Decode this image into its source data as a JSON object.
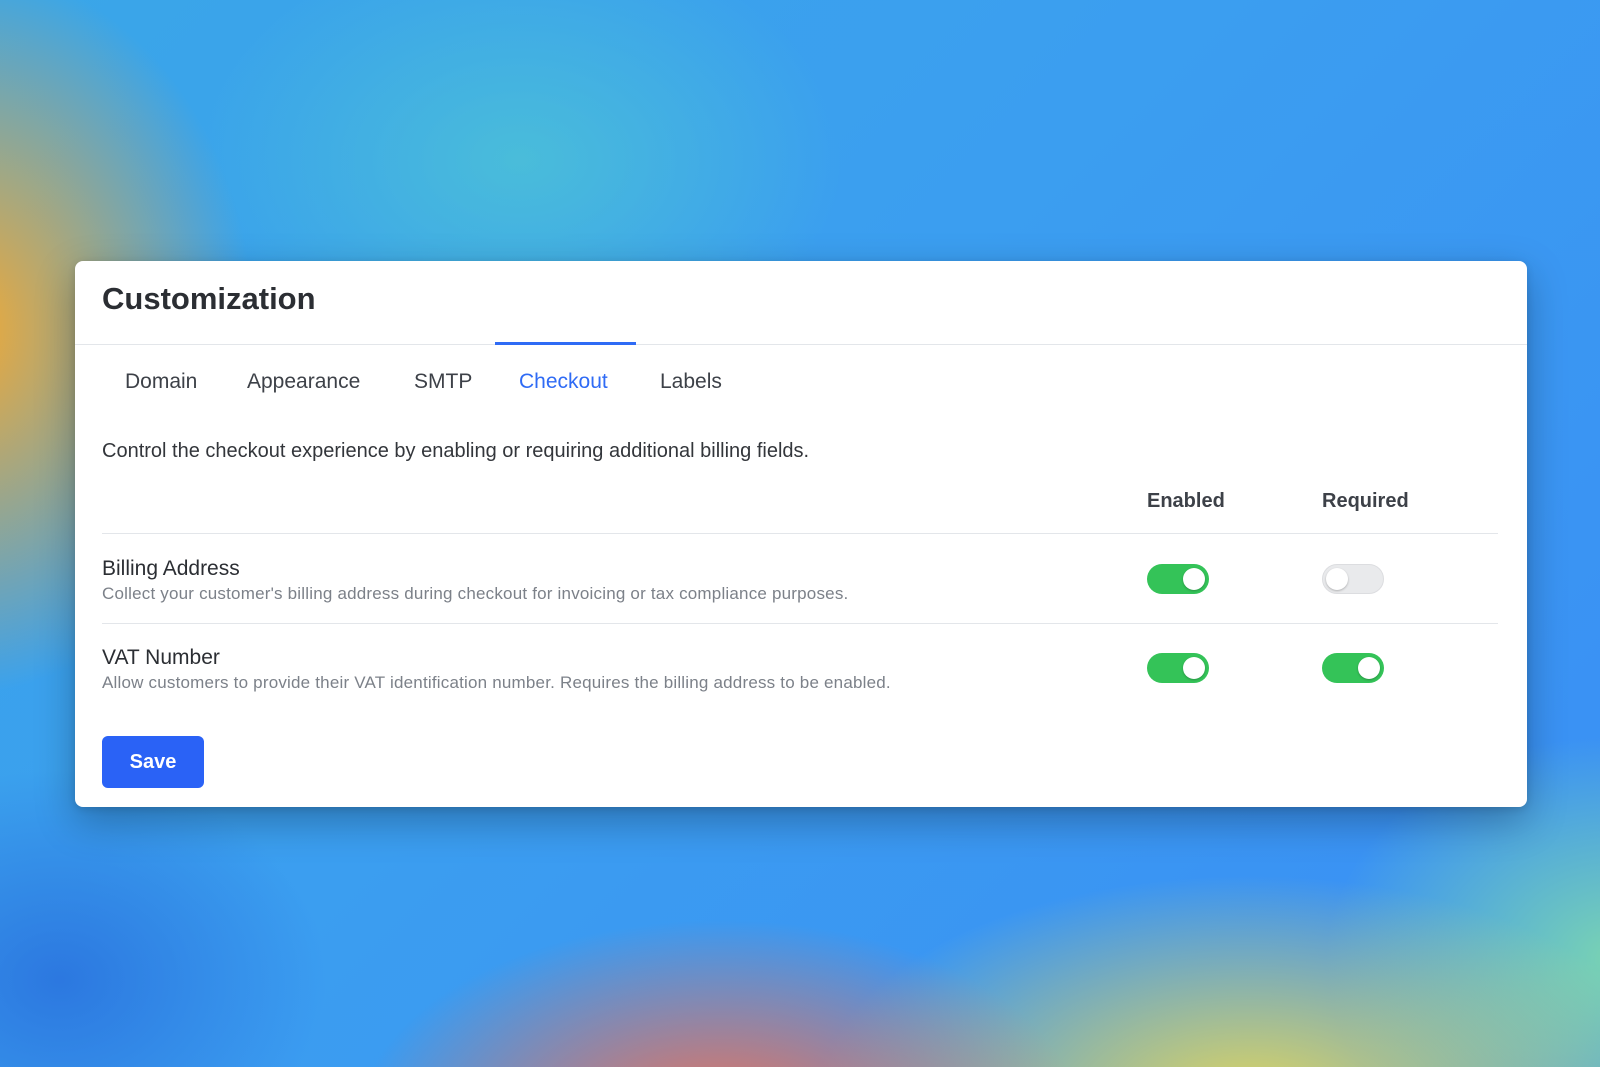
{
  "header": {
    "title": "Customization"
  },
  "tabs": [
    {
      "label": "Domain",
      "active": false
    },
    {
      "label": "Appearance",
      "active": false
    },
    {
      "label": "SMTP",
      "active": false
    },
    {
      "label": "Checkout",
      "active": true
    },
    {
      "label": "Labels",
      "active": false
    }
  ],
  "checkout": {
    "description": "Control the checkout experience by enabling or requiring additional billing fields.",
    "columns": {
      "enabled": "Enabled",
      "required": "Required"
    },
    "rows": [
      {
        "title": "Billing Address",
        "description": "Collect your customer's billing address during checkout for invoicing or tax compliance purposes.",
        "enabled": true,
        "required": false
      },
      {
        "title": "VAT Number",
        "description": "Allow customers to provide their VAT identification number. Requires the billing address to be enabled.",
        "enabled": true,
        "required": true
      }
    ],
    "save_label": "Save"
  },
  "colors": {
    "accent": "#2f6bf5",
    "toggle_on": "#34c358",
    "toggle_off": "#e9eaec",
    "button": "#2a62f6"
  }
}
